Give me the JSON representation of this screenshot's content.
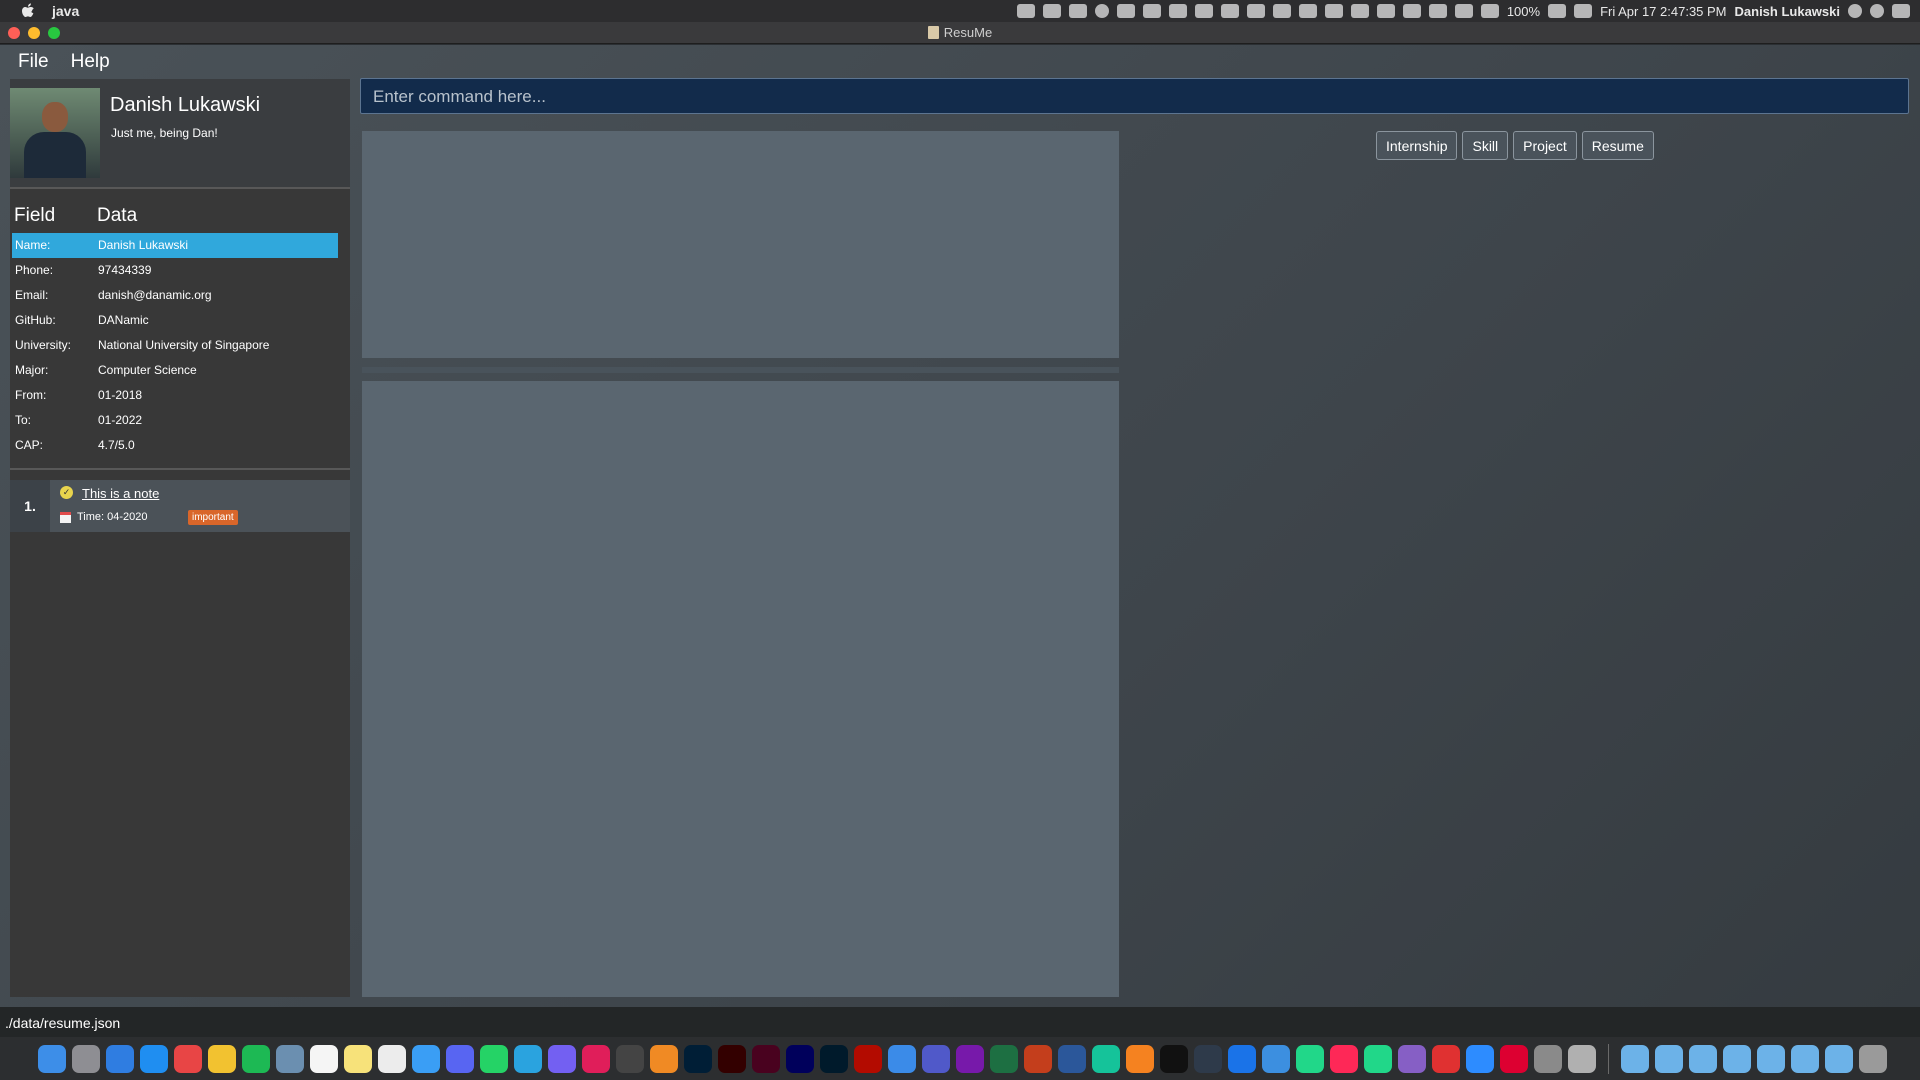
{
  "menubar": {
    "app_name": "java",
    "battery": "100%",
    "datetime": "Fri Apr 17  2:47:35 PM",
    "user": "Danish Lukawski"
  },
  "window": {
    "title": "ResuMe"
  },
  "app_menu": {
    "file": "File",
    "help": "Help"
  },
  "profile": {
    "name": "Danish Lukawski",
    "bio": "Just me, being Dan!"
  },
  "table": {
    "header_field": "Field",
    "header_data": "Data",
    "rows": [
      {
        "k": "Name:",
        "v": "Danish Lukawski"
      },
      {
        "k": "Phone:",
        "v": "97434339"
      },
      {
        "k": "Email:",
        "v": "danish@danamic.org"
      },
      {
        "k": "GitHub:",
        "v": "DANamic"
      },
      {
        "k": "University:",
        "v": "National University of Singapore"
      },
      {
        "k": "Major:",
        "v": "Computer Science"
      },
      {
        "k": "From:",
        "v": "01-2018"
      },
      {
        "k": "To:",
        "v": "01-2022"
      },
      {
        "k": "CAP:",
        "v": "4.7/5.0"
      }
    ]
  },
  "notes": [
    {
      "index": "1.",
      "title": "This is a note",
      "time": "Time: 04-2020",
      "tag": "important"
    }
  ],
  "command": {
    "placeholder": "Enter command here..."
  },
  "buttons": {
    "internship": "Internship",
    "skill": "Skill",
    "project": "Project",
    "resume": "Resume"
  },
  "statusbar": {
    "path": "./data/resume.json"
  },
  "colors": {
    "selected_row": "#30a8dc",
    "command_bg": "#122b4b",
    "tag": "#d9662a"
  }
}
